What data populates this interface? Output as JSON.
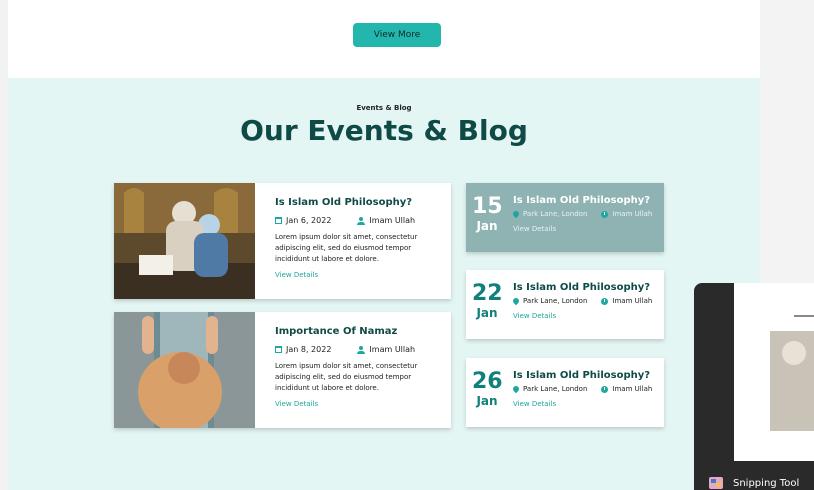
{
  "top": {
    "view_more_label": "View More"
  },
  "events": {
    "eyebrow": "Events & Blog",
    "title": "Our Events & Blog",
    "featured": [
      {
        "title": "Is Islam Old Philosophy?",
        "date": "Jan 6, 2022",
        "author": "Imam Ullah",
        "description": "Lorem ipsum dolor sit amet, consectetur adipiscing elit, sed do eiusmod tempor incididunt ut labore et dolore.",
        "link": "View Details"
      },
      {
        "title": "Importance Of Namaz",
        "date": "Jan 8, 2022",
        "author": "Imam Ullah",
        "description": "Lorem ipsum dolor sit amet, consectetur adipiscing elit, sed do eiusmod tempor incididunt ut labore et dolore.",
        "link": "View Details"
      }
    ],
    "list": [
      {
        "day": "15",
        "month": "Jan",
        "title": "Is Islam Old Philosophy?",
        "location": "Park Lane, London",
        "author": "Imam Ullah",
        "link": "View Details"
      },
      {
        "day": "22",
        "month": "Jan",
        "title": "Is Islam Old Philosophy?",
        "location": "Park Lane, London",
        "author": "Imam Ullah",
        "link": "View Details"
      },
      {
        "day": "26",
        "month": "Jan",
        "title": "Is Islam Old Philosophy?",
        "location": "Park Lane, London",
        "author": "Imam Ullah",
        "link": "View Details"
      }
    ]
  },
  "snipping_tool": {
    "label": "Snipping Tool"
  },
  "colors": {
    "accent": "#23b6ad",
    "heading": "#0f4a47",
    "section_bg": "#e4f6f4"
  }
}
